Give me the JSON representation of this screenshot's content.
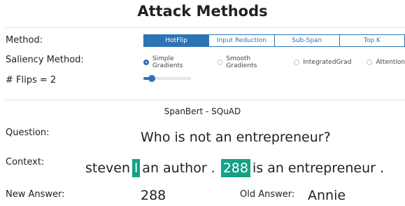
{
  "title": "Attack Methods",
  "method": {
    "label": "Method:",
    "tabs": [
      {
        "label": "HotFlip",
        "active": true
      },
      {
        "label": "Input Reduction",
        "active": false
      },
      {
        "label": "Sub-Span",
        "active": false
      },
      {
        "label": "Top K",
        "active": false
      }
    ]
  },
  "saliency": {
    "label": "Saliency Method:",
    "options": [
      {
        "label": "Simple Gradients",
        "selected": true
      },
      {
        "label": "Smooth Gradients",
        "selected": false
      },
      {
        "label": "IntegratedGrad",
        "selected": false
      },
      {
        "label": "Attention",
        "selected": false
      }
    ]
  },
  "flips": {
    "label": "# Flips = 2",
    "value": 2
  },
  "model_name": "SpanBert - SQuAD",
  "question": {
    "label": "Question:",
    "text": "Who is not an entrepreneur?"
  },
  "context": {
    "label": "Context:",
    "part1": "steven",
    "flip1": "l",
    "part2": "an author .",
    "flip2": "288",
    "part3": "is an entrepreneur ."
  },
  "new_answer": {
    "label": "New Answer:",
    "value": "288"
  },
  "old_answer": {
    "label": "Old Answer:",
    "value": "Annie"
  },
  "colors": {
    "accent": "#2e74b5",
    "highlight": "#16a085"
  }
}
